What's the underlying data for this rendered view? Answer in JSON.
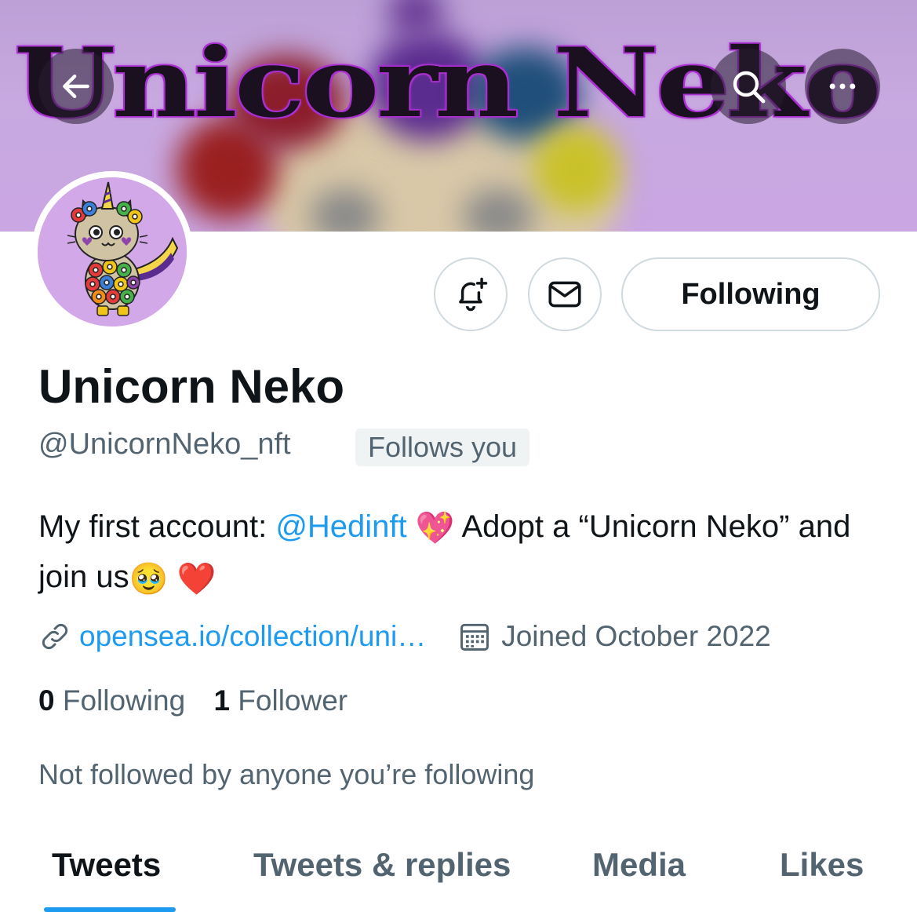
{
  "banner": {
    "title": "Unicorn Neko"
  },
  "header": {
    "back_icon": "arrow-left-icon",
    "search_icon": "search-icon",
    "more_icon": "more-horizontal-icon"
  },
  "profile": {
    "name": "Unicorn Neko",
    "handle": "@UnicornNeko_nft",
    "follows_you_badge": "Follows you",
    "following_button": "Following",
    "bio": {
      "part1": "My first account: ",
      "mention": "@Hedinft",
      "emoji_heart_sparkle": "💖",
      "part2": " Adopt a “Unicorn Neko” and join us",
      "emoji_pleading": "🥹",
      "emoji_heart": "❤️"
    },
    "website": "opensea.io/collection/uni…",
    "joined": "Joined October 2022",
    "following_count": "0",
    "following_label": "Following",
    "followers_count": "1",
    "followers_label": "Follower",
    "not_followed_text": "Not followed by anyone you’re following"
  },
  "tabs": [
    {
      "label": "Tweets",
      "active": true
    },
    {
      "label": "Tweets & replies",
      "active": false
    },
    {
      "label": "Media",
      "active": false
    },
    {
      "label": "Likes",
      "active": false
    }
  ],
  "colors": {
    "accent": "#1d9bf0",
    "text_primary": "#0f1419",
    "text_secondary": "#536471",
    "banner_purple": "#c8a9e0"
  }
}
